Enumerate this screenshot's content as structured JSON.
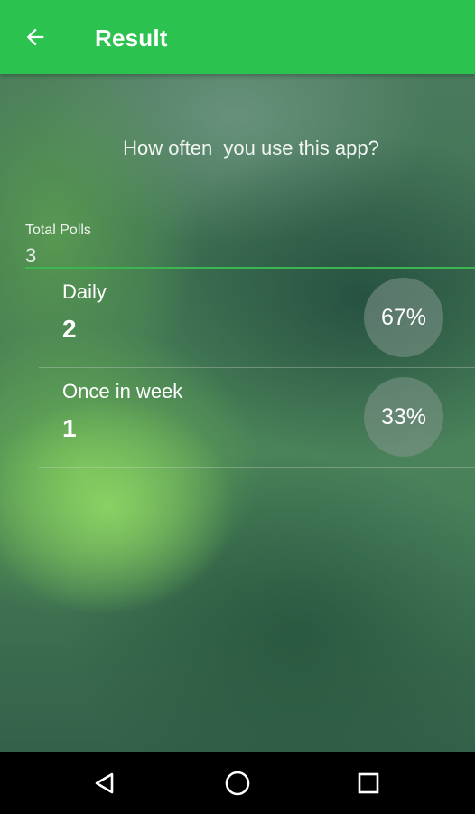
{
  "app_bar": {
    "title": "Result",
    "back_icon": "arrow-back-icon",
    "color": "#2bc24f"
  },
  "poll": {
    "question": "How often  you use this app?",
    "total_label": "Total Polls",
    "total_value": "3",
    "options": [
      {
        "label": "Daily",
        "count": "2",
        "percent": "67%"
      },
      {
        "label": "Once in week",
        "count": "1",
        "percent": "33%"
      }
    ]
  },
  "nav_bar": {
    "back_icon": "triangle-back-icon",
    "home_icon": "circle-home-icon",
    "recents_icon": "square-recents-icon"
  }
}
